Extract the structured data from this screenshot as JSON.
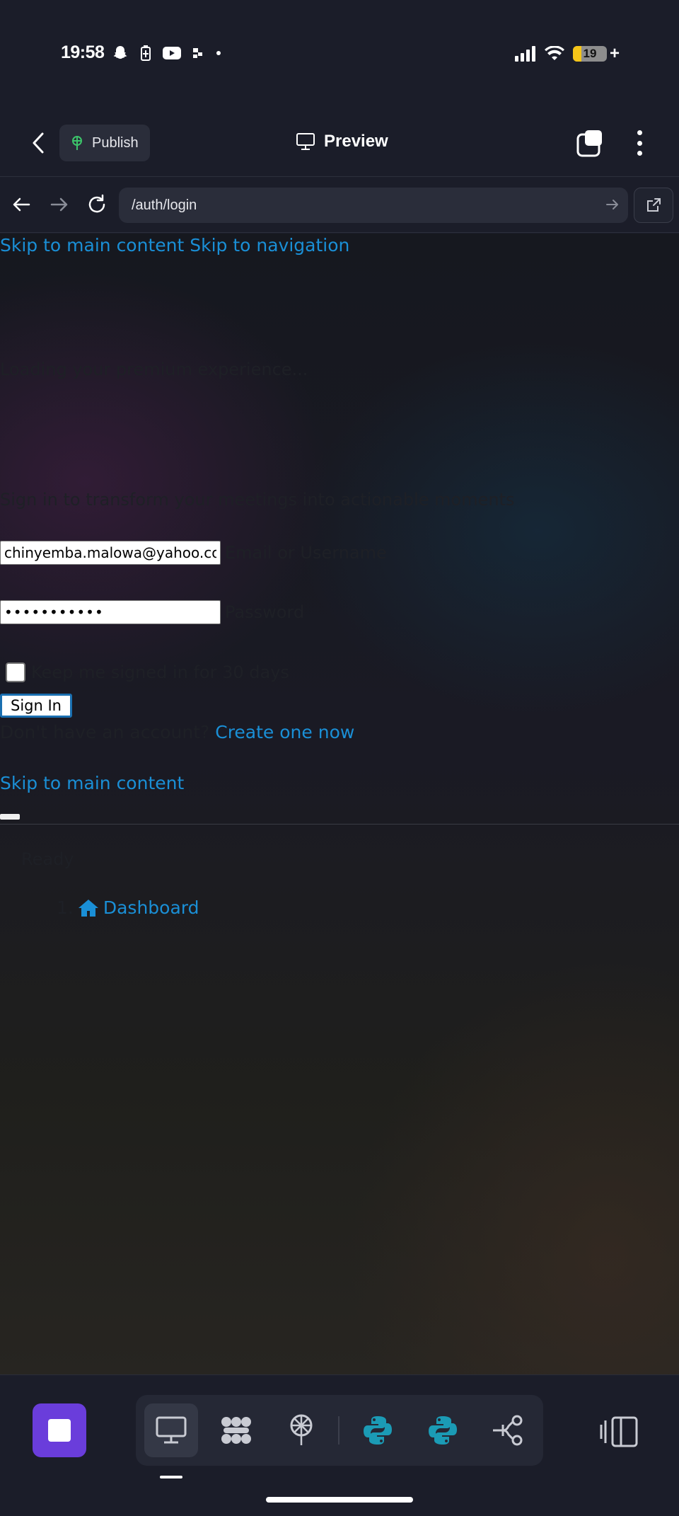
{
  "status_bar": {
    "time": "19:58",
    "battery": "19"
  },
  "app_bar": {
    "publish_label": "Publish",
    "preview_label": "Preview"
  },
  "browser": {
    "url": "/auth/login"
  },
  "page": {
    "skip_main": "Skip to main content",
    "skip_nav": "Skip to navigation",
    "brand": "",
    "tagline": "Loading your premium experience...",
    "subtitle": "Sign in to transform your meetings into actionable moments",
    "email_value": "chinyemba.malowa@yahoo.co.",
    "email_label": "Email or Username",
    "password_value": "•••••••••••",
    "password_label": "Password",
    "remember_label": "Keep me signed in for 30 days",
    "signin_label": "Sign In",
    "no_account": "Don't have an account?",
    "create_account": "Create one now",
    "skip_main_2": "Skip to main content",
    "ready": "Ready",
    "breadcrumb_number": "1.",
    "breadcrumb_label": "Dashboard"
  },
  "colors": {
    "link": "#1a8fd6",
    "stop_button": "#6a3ddb",
    "python_icon": "#1b9bb5",
    "publish_icon": "#3cc46a"
  }
}
